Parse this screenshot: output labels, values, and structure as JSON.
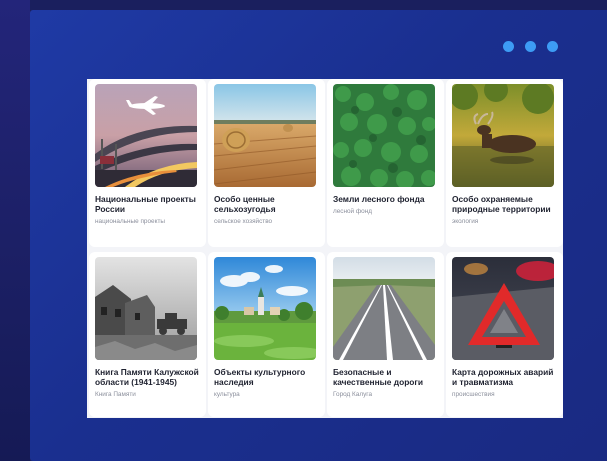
{
  "menu": {
    "icon": "more-dots-icon"
  },
  "cards": [
    {
      "title": "Национальные проекты России",
      "tag": "национальные проекты",
      "image": "highway-interchange-airplane-photo"
    },
    {
      "title": "Особо ценные сельхозугодья",
      "tag": "сельское хозяйство",
      "image": "hay-bales-field-photo"
    },
    {
      "title": "Земли лесного фонда",
      "tag": "лесной фонд",
      "image": "forest-aerial-photo"
    },
    {
      "title": "Особо охраняемые природные территории",
      "tag": "экология",
      "image": "moose-in-water-photo"
    },
    {
      "title": "Книга Памяти Калужской области (1941-1945)",
      "tag": "Книга Памяти",
      "image": "war-ruins-photo"
    },
    {
      "title": "Объекты культурного наследия",
      "tag": "культура",
      "image": "village-church-landscape-photo"
    },
    {
      "title": "Безопасные и качественные дороги",
      "tag": "Город Калуга",
      "image": "empty-road-photo"
    },
    {
      "title": "Карта дорожных аварий и травматизма",
      "tag": "происшествия",
      "image": "warning-triangle-photo"
    }
  ]
}
